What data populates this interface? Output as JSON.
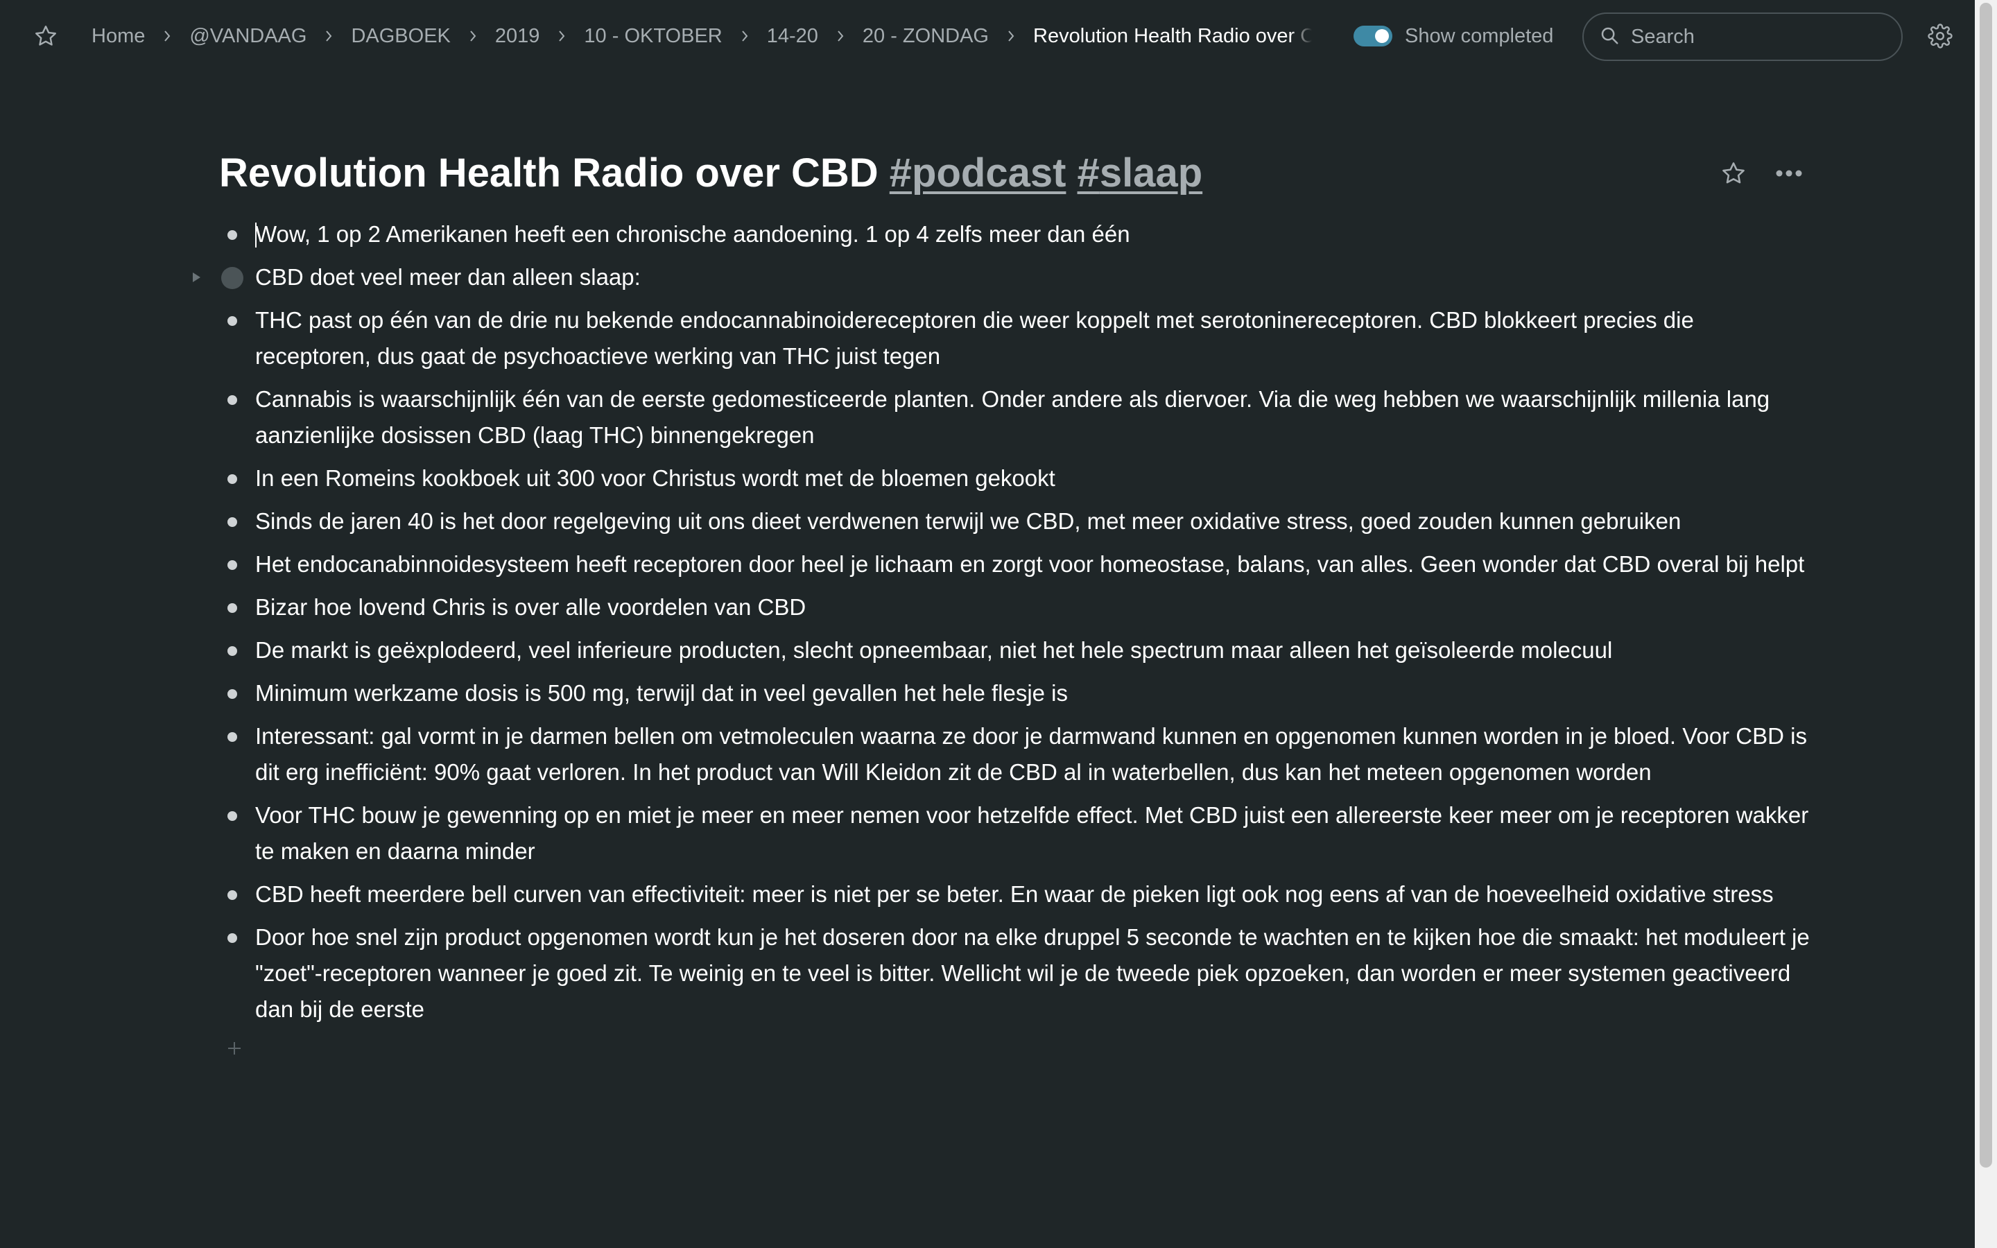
{
  "topbar": {
    "star_icon": "star-outline-icon",
    "breadcrumb": [
      {
        "label": "Home"
      },
      {
        "label": "@VANDAAG"
      },
      {
        "label": "DAGBOEK"
      },
      {
        "label": "2019"
      },
      {
        "label": "10 - OKTOBER"
      },
      {
        "label": "14-20"
      },
      {
        "label": "20 - ZONDAG"
      }
    ],
    "current_page": "Revolution Health Radio over CBD #podcast #slaap",
    "show_completed": {
      "label": "Show completed",
      "on": true
    },
    "search": {
      "placeholder": "Search",
      "value": ""
    },
    "settings_icon": "gear-icon"
  },
  "page": {
    "title_text": "Revolution Health Radio over CBD",
    "tags": [
      {
        "hash": "#",
        "label": "podcast"
      },
      {
        "hash": "#",
        "label": "slaap"
      }
    ],
    "bullets": [
      {
        "text": "Wow, 1 op 2 Amerikanen heeft een chronische aandoening. 1 op 4 zelfs meer dan één"
      },
      {
        "text": "CBD doet veel meer dan alleen slaap:",
        "collapsed": true
      },
      {
        "text": "THC past op één van de drie nu bekende endocannabinoidereceptoren die weer koppelt met serotoninereceptoren. CBD blokkeert precies die receptoren, dus gaat de psychoactieve werking van THC juist tegen"
      },
      {
        "text": "Cannabis is waarschijnlijk één van de eerste gedomesticeerde planten. Onder andere als diervoer. Via die weg hebben we waarschijnlijk millenia lang aanzienlijke dosissen CBD (laag THC) binnengekregen"
      },
      {
        "text": "In een Romeins kookboek uit 300 voor Christus wordt met de bloemen gekookt"
      },
      {
        "text": "Sinds de jaren 40 is het door regelgeving uit ons dieet verdwenen terwijl we CBD, met meer oxidative stress, goed zouden kunnen gebruiken"
      },
      {
        "text": "Het endocanabinnoidesysteem heeft receptoren door heel je lichaam en zorgt voor homeostase, balans, van alles. Geen wonder dat CBD overal bij helpt"
      },
      {
        "text": "Bizar hoe lovend Chris is over alle voordelen van CBD"
      },
      {
        "text": "De markt is geëxplodeerd, veel inferieure producten, slecht opneembaar, niet het hele spectrum maar alleen het geïsoleerde molecuul"
      },
      {
        "text": "Minimum werkzame dosis is 500 mg, terwijl dat in veel gevallen het hele flesje is"
      },
      {
        "text": "Interessant: gal vormt in je darmen bellen om vetmoleculen waarna ze door je darmwand kunnen en opgenomen kunnen worden in je bloed. Voor CBD is dit erg inefficiënt: 90% gaat verloren. In het product van Will Kleidon zit de CBD al in waterbellen, dus kan het meteen opgenomen worden"
      },
      {
        "text": "Voor THC bouw je gewenning op en miet je meer en meer nemen voor hetzelfde effect. Met CBD juist een allereerste keer meer om je receptoren wakker te maken en daarna minder"
      },
      {
        "text": "CBD heeft meerdere bell curven van effectiviteit: meer is niet per se beter. En waar de pieken ligt ook nog eens af van de hoeveelheid oxidative stress"
      },
      {
        "text": "Door hoe snel zijn product opgenomen wordt kun je het doseren door na elke druppel 5 seconde te wachten en te kijken hoe die smaakt: het moduleert je \"zoet\"-receptoren wanneer je goed zit. Te weinig en te veel is bitter. Wellicht wil je de tweede piek opzoeken, dan worden er meer systemen geactiveerd dan bij de eerste"
      }
    ],
    "actions": {
      "star_icon": "star-outline-icon",
      "more_icon": "more-horizontal-icon",
      "add_icon": "plus-icon"
    }
  },
  "colors": {
    "background": "#1f2628",
    "text": "#ffffff",
    "muted": "#a6adb1",
    "accent": "#3e89a5"
  }
}
